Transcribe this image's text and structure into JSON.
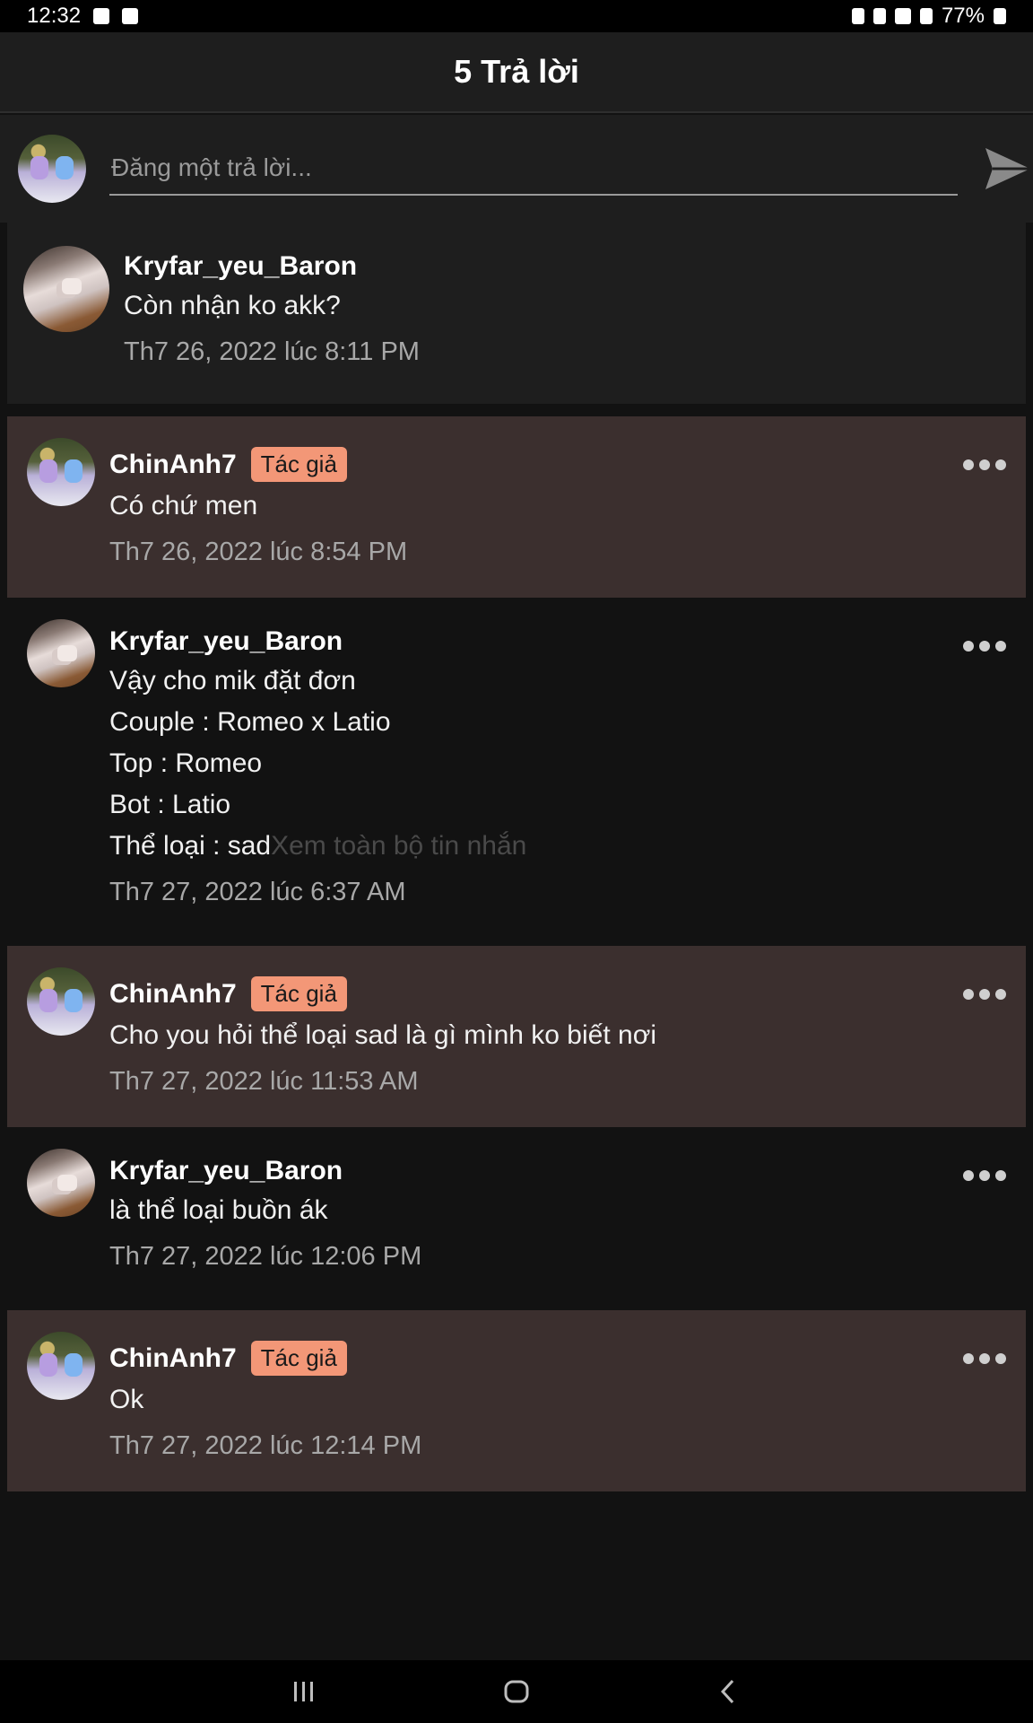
{
  "status_bar": {
    "time": "12:32",
    "battery": "77%"
  },
  "header": {
    "title": "5 Trả lời"
  },
  "compose": {
    "placeholder": "Đăng một trả lời..."
  },
  "root_comment": {
    "username": "Kryfar_yeu_Baron",
    "message": "Còn nhận ko akk?",
    "time": "Th7 26, 2022 lúc 8:11 PM"
  },
  "replies": [
    {
      "username": "ChinAnh7",
      "badge": "Tác giả",
      "lines": [
        "Có chứ men"
      ],
      "time": "Th7 26, 2022 lúc 8:54 PM"
    },
    {
      "username": "Kryfar_yeu_Baron",
      "lines": [
        "Vậy cho mik đặt đơn",
        "Couple : Romeo x Latio",
        "Top : Romeo",
        "Bot : Latio",
        "Thể loại : sad"
      ],
      "expand": "Xem toàn bộ tin nhắn",
      "time": "Th7 27, 2022 lúc 6:37 AM"
    },
    {
      "username": "ChinAnh7",
      "badge": "Tác giả",
      "lines": [
        "Cho you hỏi thể loại sad là gì mình ko biết nơi"
      ],
      "time": "Th7 27, 2022 lúc 11:53 AM"
    },
    {
      "username": "Kryfar_yeu_Baron",
      "lines": [
        "là thể loại buồn ák"
      ],
      "time": "Th7 27, 2022 lúc 12:06 PM"
    },
    {
      "username": "ChinAnh7",
      "badge": "Tác giả",
      "lines": [
        "Ok"
      ],
      "time": "Th7 27, 2022 lúc 12:14 PM"
    }
  ],
  "colors": {
    "background": "#121212",
    "author_highlight": "#3b2f2e",
    "badge": "#f39777"
  }
}
